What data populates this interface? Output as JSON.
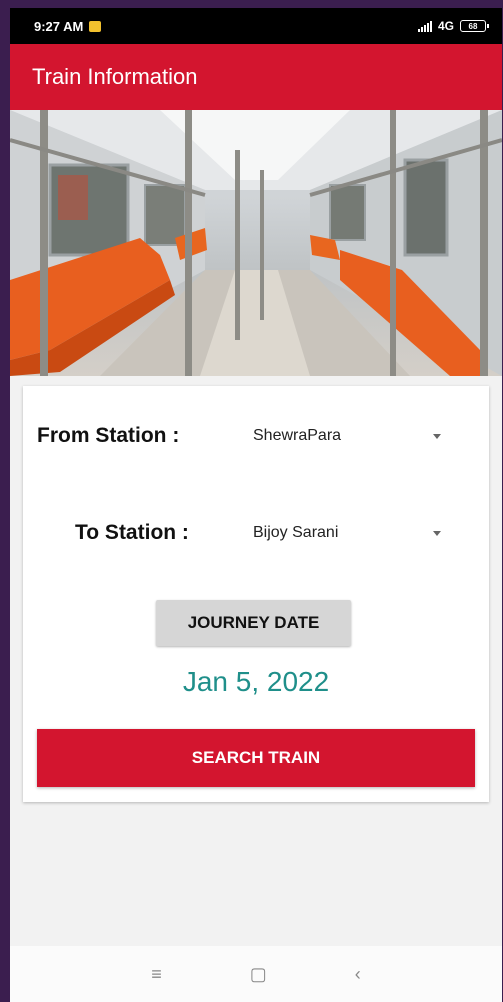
{
  "status_bar": {
    "time": "9:27 AM",
    "network": "4G",
    "battery": "68"
  },
  "app_bar": {
    "title": "Train Information"
  },
  "form": {
    "from_label": "From Station :",
    "from_value": "ShewraPara",
    "to_label": "To Station :",
    "to_value": "Bijoy Sarani",
    "journey_date_button": "JOURNEY DATE",
    "date_value": "Jan 5, 2022",
    "search_button": "SEARCH TRAIN"
  },
  "nav_bar": {
    "menu": "≡",
    "home": "▢",
    "back": "‹"
  },
  "colors": {
    "primary": "#d3152f",
    "date_text": "#1f8f8a",
    "seat": "#e85f1f"
  }
}
